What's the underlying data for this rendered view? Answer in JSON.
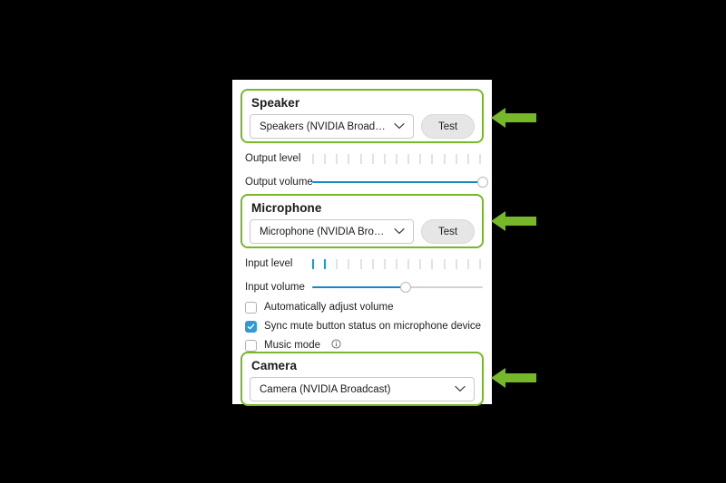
{
  "colors": {
    "background": "#000000",
    "panel": "#ffffff",
    "highlight_green": "#76b82a",
    "arrow_green": "#76b82a",
    "accent_blue": "#1a87c4",
    "meter_active": "#0a9fe0",
    "checkbox_checked": "#2e9bd6",
    "text": "#1f1f1f"
  },
  "panel": {
    "speaker": {
      "title": "Speaker",
      "device": "Speakers (NVIDIA Broadcast)",
      "test_label": "Test",
      "chevron_icon": "chevron-down-icon",
      "output_level": {
        "label": "Output level",
        "ticks_total": 15,
        "ticks_active": 0
      },
      "output_volume": {
        "label": "Output volume",
        "value_percent": 100
      }
    },
    "microphone": {
      "title": "Microphone",
      "device": "Microphone (NVIDIA Broadcast)",
      "test_label": "Test",
      "chevron_icon": "chevron-down-icon",
      "input_level": {
        "label": "Input level",
        "ticks_total": 15,
        "ticks_active": 2
      },
      "input_volume": {
        "label": "Input volume",
        "value_percent": 55
      },
      "options": [
        {
          "label": "Automatically adjust volume",
          "checked": false,
          "info": false
        },
        {
          "label": "Sync mute button status on microphone device",
          "checked": true,
          "info": false
        },
        {
          "label": "Music mode",
          "checked": false,
          "info": true,
          "info_icon": "info-circle-icon"
        }
      ]
    },
    "camera": {
      "title": "Camera",
      "device": "Camera (NVIDIA Broadcast)",
      "chevron_icon": "chevron-down-icon"
    }
  },
  "annotations": {
    "arrows": [
      {
        "name": "arrow-speaker",
        "direction": "left",
        "icon": "arrow-left-icon"
      },
      {
        "name": "arrow-microphone",
        "direction": "left",
        "icon": "arrow-left-icon"
      },
      {
        "name": "arrow-camera",
        "direction": "left",
        "icon": "arrow-left-icon"
      }
    ]
  }
}
